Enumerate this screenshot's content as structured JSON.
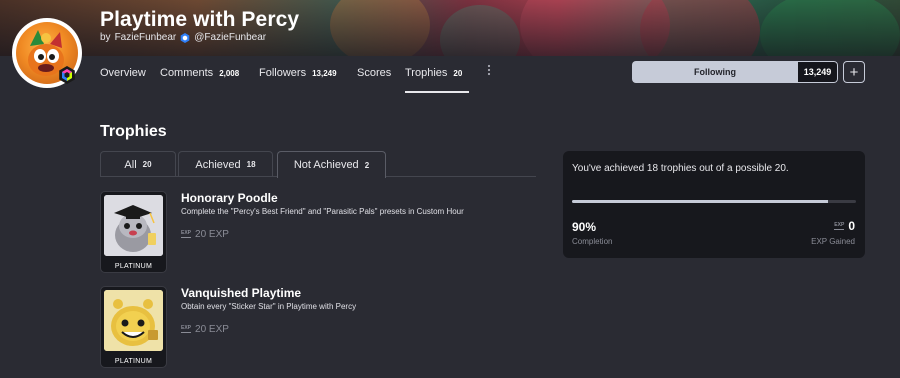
{
  "game": {
    "title": "Playtime with Percy",
    "by_prefix": "by",
    "developer_name": "FazieFunbear",
    "developer_handle": "@FazieFunbear"
  },
  "nav": {
    "overview": "Overview",
    "comments_label": "Comments",
    "comments_count": "2,008",
    "followers_label": "Followers",
    "followers_count": "13,249",
    "scores": "Scores",
    "trophies_label": "Trophies",
    "trophies_count": "20",
    "more_icon": "vertical-dots-icon"
  },
  "follow": {
    "label": "Following",
    "count": "13,249",
    "plus": "+"
  },
  "section": {
    "title": "Trophies"
  },
  "tabs": [
    {
      "label": "All",
      "count": "20"
    },
    {
      "label": "Achieved",
      "count": "18"
    },
    {
      "label": "Not Achieved",
      "count": "2"
    }
  ],
  "trophies": [
    {
      "name": "Honorary Poodle",
      "description": "Complete the \"Percy's Best Friend\" and \"Parasitic Pals\" presets in Custom Hour",
      "exp": "20 EXP",
      "rank": "PLATINUM"
    },
    {
      "name": "Vanquished Playtime",
      "description": "Obtain every \"Sticker Star\" in Playtime with Percy",
      "exp": "20 EXP",
      "rank": "PLATINUM"
    }
  ],
  "exp_tag": "EXP",
  "summary": {
    "text": "You've achieved 18 trophies out of a possible 20.",
    "percent": "90%",
    "progress_fraction": 0.9,
    "completion_label": "Completion",
    "exp_value": "0",
    "exp_label": "EXP Gained"
  },
  "colors": {
    "background": "#2a2b33",
    "card": "#17181d",
    "accent_light": "#c6cbd8"
  }
}
